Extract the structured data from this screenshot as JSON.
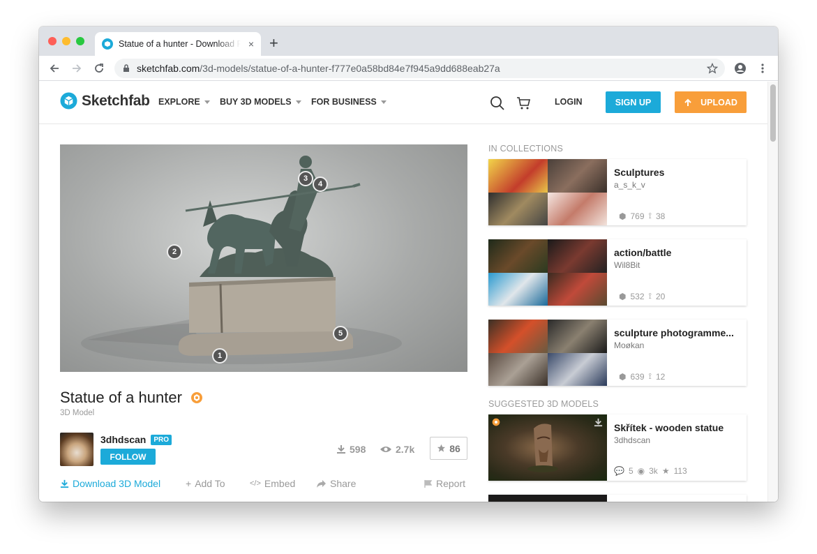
{
  "browser": {
    "tab_title": "Statue of a hunter - Download Free",
    "tab_close": "×",
    "new_tab": "+",
    "url_host": "sketchfab.com",
    "url_path": "/3d-models/statue-of-a-hunter-f777e0a58bd84e7f945a9dd688eab27a"
  },
  "site": {
    "logo": "Sketchfab",
    "menu": [
      "EXPLORE",
      "BUY 3D MODELS",
      "FOR BUSINESS"
    ],
    "login": "LOGIN",
    "signup": "SIGN UP",
    "upload": "UPLOAD"
  },
  "model": {
    "title": "Statue of a hunter",
    "subtitle": "3D Model",
    "hotspots": [
      "1",
      "2",
      "3",
      "4",
      "5"
    ],
    "author": "3dhdscan",
    "pro": "PRO",
    "follow": "FOLLOW",
    "downloads": "598",
    "views": "2.7k",
    "likes": "86",
    "actions": {
      "download": "Download 3D Model",
      "add": "Add To",
      "embed": "Embed",
      "share": "Share",
      "report": "Report"
    }
  },
  "sidebar": {
    "collections_label": "IN COLLECTIONS",
    "collections": [
      {
        "title": "Sculptures",
        "author": "a_s_k_v",
        "models": "769",
        "followers": "38"
      },
      {
        "title": "action/battle",
        "author": "Wil8Bit",
        "models": "532",
        "followers": "20"
      },
      {
        "title": "sculpture photogramme...",
        "author": "Moøkan",
        "models": "639",
        "followers": "12"
      }
    ],
    "suggested_label": "SUGGESTED 3D MODELS",
    "suggested": [
      {
        "title": "Skřítek - wooden statue",
        "author": "3dhdscan",
        "comments": "5",
        "views": "3k",
        "likes": "113"
      }
    ]
  },
  "colors": {
    "brand_blue": "#1caad9",
    "upload_orange": "#f89e3a"
  }
}
